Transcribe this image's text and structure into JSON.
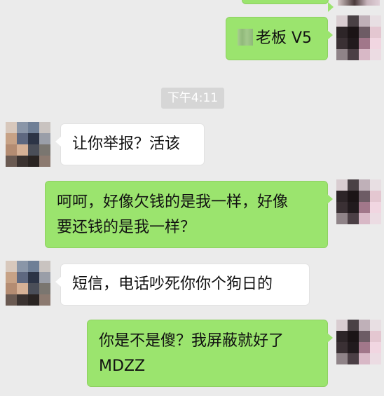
{
  "conversation": {
    "messages": [
      {
        "side": "right",
        "text": "老板 V5",
        "blurred_prefix": true
      },
      {
        "side": "left",
        "text": "让你举报？活该"
      },
      {
        "side": "right",
        "lines": [
          "呵呵，好像欠钱的是我一样，好像",
          "要还钱的是我一样？"
        ]
      },
      {
        "side": "left",
        "text": "短信，电话吵死你你个狗日的"
      },
      {
        "side": "right",
        "lines": [
          "你是不是傻？我屏蔽就好了",
          "MDZZ"
        ]
      }
    ],
    "timestamp": "下午4:11"
  },
  "colors": {
    "background": "#ebebeb",
    "bubble_me": "#9be46e",
    "bubble_other": "#ffffff",
    "timestamp_bg": "#d6d6d6"
  },
  "icons": {
    "avatar_other": "pixelated-avatar",
    "avatar_me": "pixelated-avatar"
  }
}
